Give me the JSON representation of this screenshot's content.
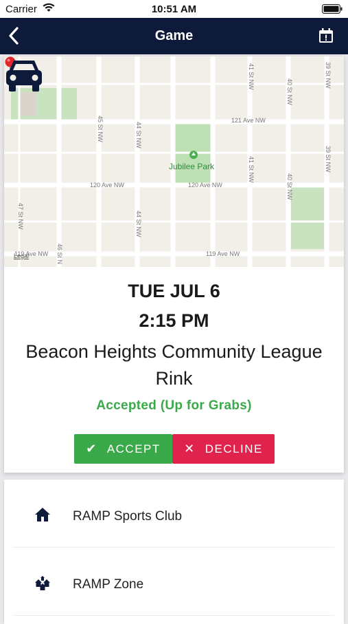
{
  "status_bar": {
    "carrier": "Carrier",
    "time": "10:51 AM"
  },
  "nav": {
    "title": "Game",
    "back_icon": "chevron-left-icon",
    "calendar_icon": "calendar-alert-icon"
  },
  "map": {
    "roads_horizontal": [
      "121 Ave NW",
      "120 Ave NW",
      "120 Ave NW",
      "119 Ave NW",
      "119 Ave NW"
    ],
    "roads_vertical": [
      "45 St NW",
      "44 St NW",
      "41 St NW",
      "40 St NW",
      "39 St NW",
      "41 St NW",
      "40 St NW",
      "39 St NW",
      "47 St NW",
      "44 St NW",
      "46 St N"
    ],
    "park_name": "Jubilee Park",
    "legal": "Legal",
    "directions_icon": "car-icon"
  },
  "game": {
    "date": "TUE JUL 6",
    "time": "2:15 PM",
    "venue": "Beacon Heights Community League Rink",
    "status": "Accepted (Up for Grabs)",
    "accept_label": "ACCEPT",
    "decline_label": "DECLINE"
  },
  "list": [
    {
      "label": "RAMP Sports Club",
      "icon": "home-icon"
    },
    {
      "label": "RAMP Zone",
      "icon": "home-group-icon"
    }
  ],
  "colors": {
    "nav": "#0e1a3a",
    "accept": "#3aa94a",
    "decline": "#e0234d",
    "status": "#3aa94a"
  }
}
